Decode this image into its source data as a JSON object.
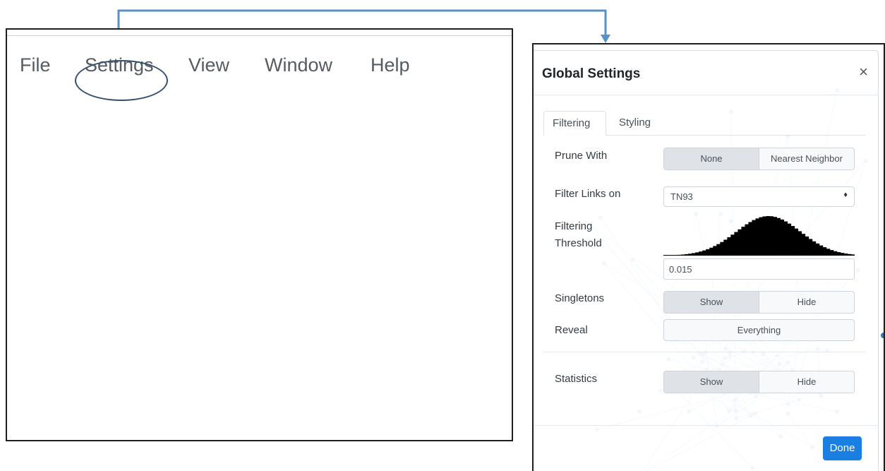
{
  "menubar": {
    "items": [
      "File",
      "Settings",
      "View",
      "Window",
      "Help"
    ]
  },
  "dialog": {
    "title": "Global Settings",
    "close_glyph": "×",
    "tabs": [
      "Filtering",
      "Styling"
    ],
    "prune": {
      "label": "Prune With",
      "options": [
        "None",
        "Nearest Neighbor"
      ],
      "selected": "None"
    },
    "filter_links": {
      "label": "Filter Links on",
      "value": "TN93",
      "arrow": "≑"
    },
    "threshold": {
      "label_line1": "Filtering",
      "label_line2": "Threshold",
      "value": "0.015"
    },
    "singletons": {
      "label": "Singletons",
      "options": [
        "Show",
        "Hide"
      ],
      "selected": "Show"
    },
    "reveal": {
      "label": "Reveal",
      "value": "Everything"
    },
    "statistics": {
      "label": "Statistics",
      "options": [
        "Show",
        "Hide"
      ],
      "selected": "Show"
    },
    "done_label": "Done"
  },
  "colors": {
    "accent": "#1a7fe0",
    "connector": "#5b92c6",
    "highlight": "#34506e"
  }
}
